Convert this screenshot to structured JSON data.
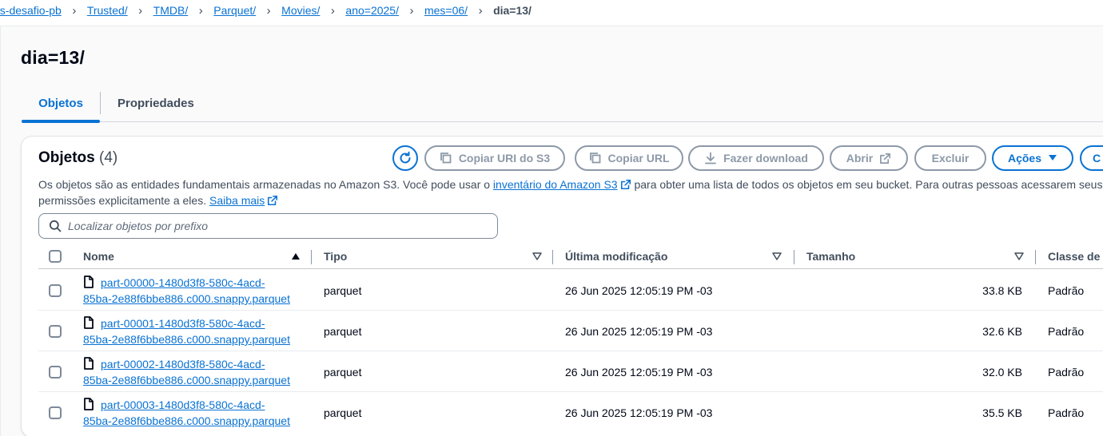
{
  "breadcrumbs": [
    {
      "label": "us-desafio-pb"
    },
    {
      "label": "Trusted/"
    },
    {
      "label": "TMDB/"
    },
    {
      "label": "Parquet/"
    },
    {
      "label": "Movies/"
    },
    {
      "label": "ano=2025/"
    },
    {
      "label": "mes=06/"
    }
  ],
  "breadcrumb_current": "dia=13/",
  "page_title": "dia=13/",
  "tabs": [
    {
      "label": "Objetos",
      "active": true
    },
    {
      "label": "Propriedades",
      "active": false
    }
  ],
  "objects_panel": {
    "title": "Objetos",
    "count": "(4)",
    "buttons": {
      "copy_uri": "Copiar URI do S3",
      "copy_url": "Copiar URL",
      "download": "Fazer download",
      "open": "Abrir",
      "delete": "Excluir",
      "actions": "Ações",
      "create_folder": "C"
    },
    "description_part1": "Os objetos são as entidades fundamentais armazenadas no Amazon S3. Você pode usar o ",
    "description_link": "inventário do Amazon S3",
    "description_part2": " para obter uma lista de todos os objetos em seu bucket. Para outras pessoas acessarem seus objetos, você precisará conceder",
    "description_part3": "permissões explicitamente a eles. ",
    "learn_more": "Saiba mais",
    "search_placeholder": "Localizar objetos por prefixo"
  },
  "table": {
    "columns": {
      "name": "Nome",
      "type": "Tipo",
      "modified": "Última modificação",
      "size": "Tamanho",
      "storage_class": "Classe de armazenamento"
    },
    "rows": [
      {
        "name_line1": "part-00000-1480d3f8-580c-4acd-",
        "name_line2": "85ba-2e88f6bbe886.c000.snappy.parquet",
        "type": "parquet",
        "modified": "26 Jun 2025 12:05:19 PM -03",
        "size": "33.8 KB",
        "class": "Padrão"
      },
      {
        "name_line1": "part-00001-1480d3f8-580c-4acd-",
        "name_line2": "85ba-2e88f6bbe886.c000.snappy.parquet",
        "type": "parquet",
        "modified": "26 Jun 2025 12:05:19 PM -03",
        "size": "32.6 KB",
        "class": "Padrão"
      },
      {
        "name_line1": "part-00002-1480d3f8-580c-4acd-",
        "name_line2": "85ba-2e88f6bbe886.c000.snappy.parquet",
        "type": "parquet",
        "modified": "26 Jun 2025 12:05:19 PM -03",
        "size": "32.0 KB",
        "class": "Padrão"
      },
      {
        "name_line1": "part-00003-1480d3f8-580c-4acd-",
        "name_line2": "85ba-2e88f6bbe886.c000.snappy.parquet",
        "type": "parquet",
        "modified": "26 Jun 2025 12:05:19 PM -03",
        "size": "35.5 KB",
        "class": "Padrão"
      }
    ]
  },
  "colors": {
    "link": "#0972d3",
    "text": "#000716",
    "disabled": "#8d99a8"
  },
  "icons": [
    "chevron-right-icon",
    "refresh-icon",
    "copy-icon",
    "download-icon",
    "external-link-icon",
    "caret-down-icon",
    "search-icon",
    "sort-ascending-icon",
    "sort-icon",
    "file-icon"
  ]
}
